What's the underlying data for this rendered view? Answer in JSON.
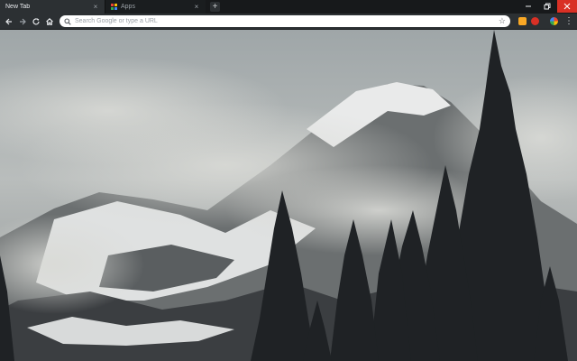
{
  "tabs": [
    {
      "title": "New Tab",
      "active": true
    },
    {
      "title": "Apps",
      "active": false
    }
  ],
  "omnibox": {
    "placeholder": "Search Google or type a URL"
  },
  "colors": {
    "tab_strip": "#17191b",
    "toolbar": "#2c3033",
    "window_close": "#d93025",
    "extensions": [
      "#f9a825",
      "#d93025",
      "#34a853"
    ]
  },
  "icons": {
    "back": "arrow-left-icon",
    "forward": "arrow-right-icon",
    "reload": "reload-icon",
    "home": "home-icon",
    "search": "search-icon",
    "bookmark": "star-icon",
    "menu": "kebab-menu-icon"
  }
}
